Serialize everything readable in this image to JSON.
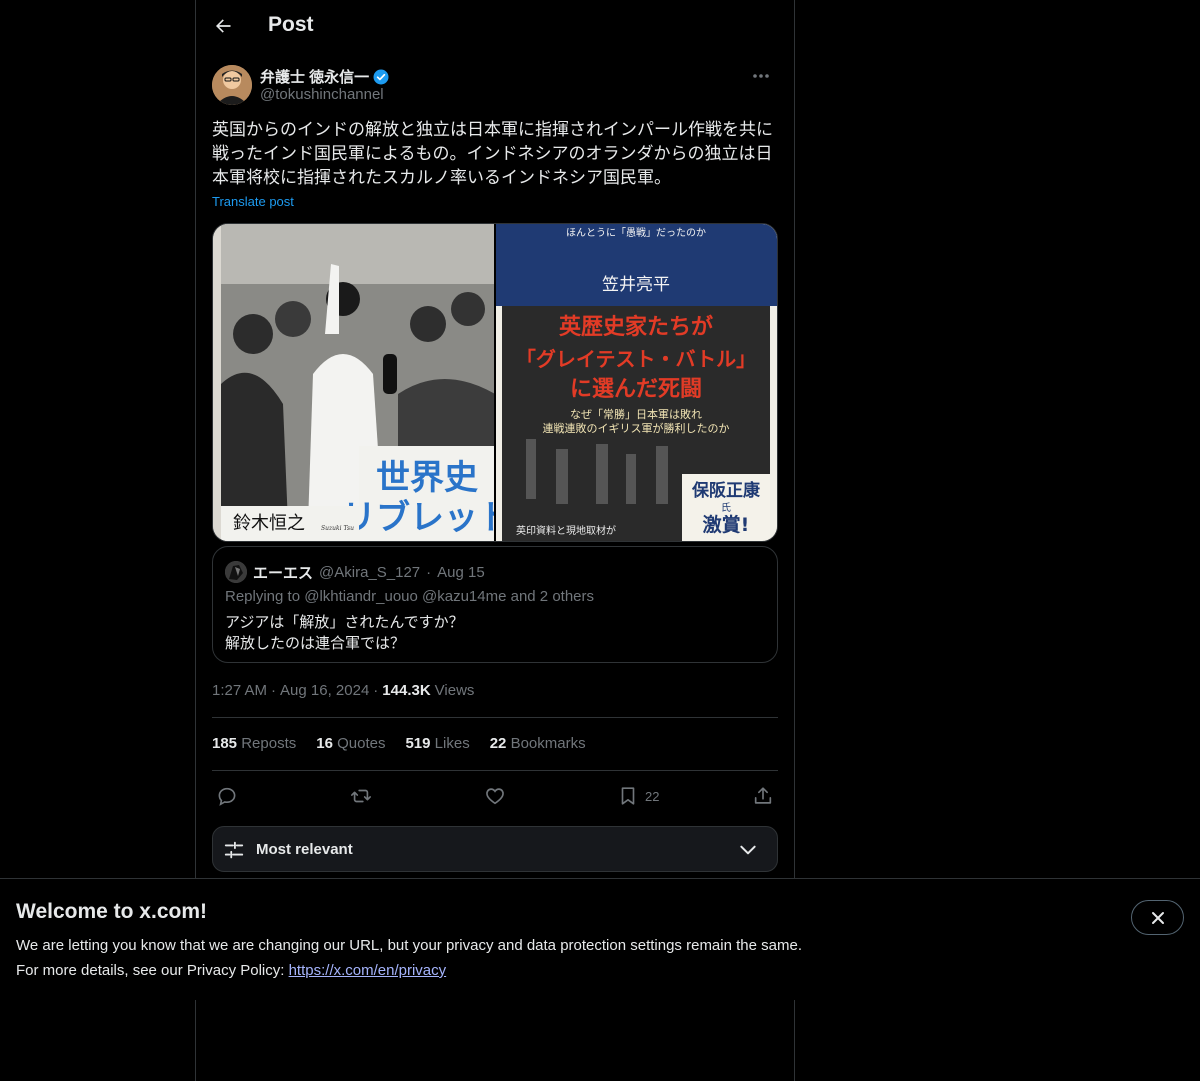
{
  "header": {
    "title": "Post"
  },
  "post": {
    "author": {
      "display_name": "弁護士 徳永信一",
      "handle": "@tokushinchannel",
      "verified": true
    },
    "text": "英国からのインドの解放と独立は日本軍に指揮されインパール作戦を共に戦ったインド国民軍によるもの。インドネシアのオランダからの独立は日本軍将校に指揮されたスカルノ率いるインドネシア国民軍。",
    "translate_label": "Translate post",
    "media": {
      "left_caption_main_1": "世界史",
      "left_caption_main_2": "リブレット",
      "left_caption_author": "鈴木恒之",
      "left_caption_author_sub": "Suzuki Tsu",
      "right_top_text": "ほんとうに「愚戦」だったのか",
      "right_author": "笠井亮平",
      "right_headline_1": "英歴史家たちが",
      "right_headline_2": "「グレイテスト・バトル」",
      "right_headline_3": "に選んだ死闘",
      "right_sub_1": "なぜ「常勝」日本軍は敗れ",
      "right_sub_2": "連戦連敗のイギリス軍が勝利したのか",
      "right_badge_1": "保阪正康",
      "right_badge_honorific": "氏",
      "right_badge_2": "激賞!",
      "right_footer": "英印資料と現地取材が"
    },
    "quote": {
      "name": "エーエス",
      "handle": "@Akira_S_127",
      "separator": "·",
      "date": "Aug 15",
      "replying_to": "Replying to @lkhtiandr_uouo @kazu14me and 2 others",
      "text_line1": "アジアは「解放」されたんですか？",
      "text_line2": "解放したのは連合軍では？"
    },
    "time": "1:27 AM",
    "dot": "·",
    "date": "Aug 16, 2024",
    "views_count": "144.3K",
    "views_label": "Views",
    "stats": {
      "reposts_count": "185",
      "reposts_label": "Reposts",
      "quotes_count": "16",
      "quotes_label": "Quotes",
      "likes_count": "519",
      "likes_label": "Likes",
      "bookmarks_count": "22",
      "bookmarks_label": "Bookmarks"
    },
    "actions": {
      "bookmark_count": "22"
    }
  },
  "sort": {
    "label": "Most relevant"
  },
  "banner": {
    "title": "Welcome to x.com!",
    "line1": "We are letting you know that we are changing our URL, but your privacy and data protection settings remain the same.",
    "line2_prefix": "For more details, see our Privacy Policy: ",
    "link": "https://x.com/en/privacy"
  },
  "colors": {
    "accent": "#1d9bf0",
    "muted": "#71767b",
    "border": "#2f3336",
    "link_banner": "#a5b4fc"
  }
}
